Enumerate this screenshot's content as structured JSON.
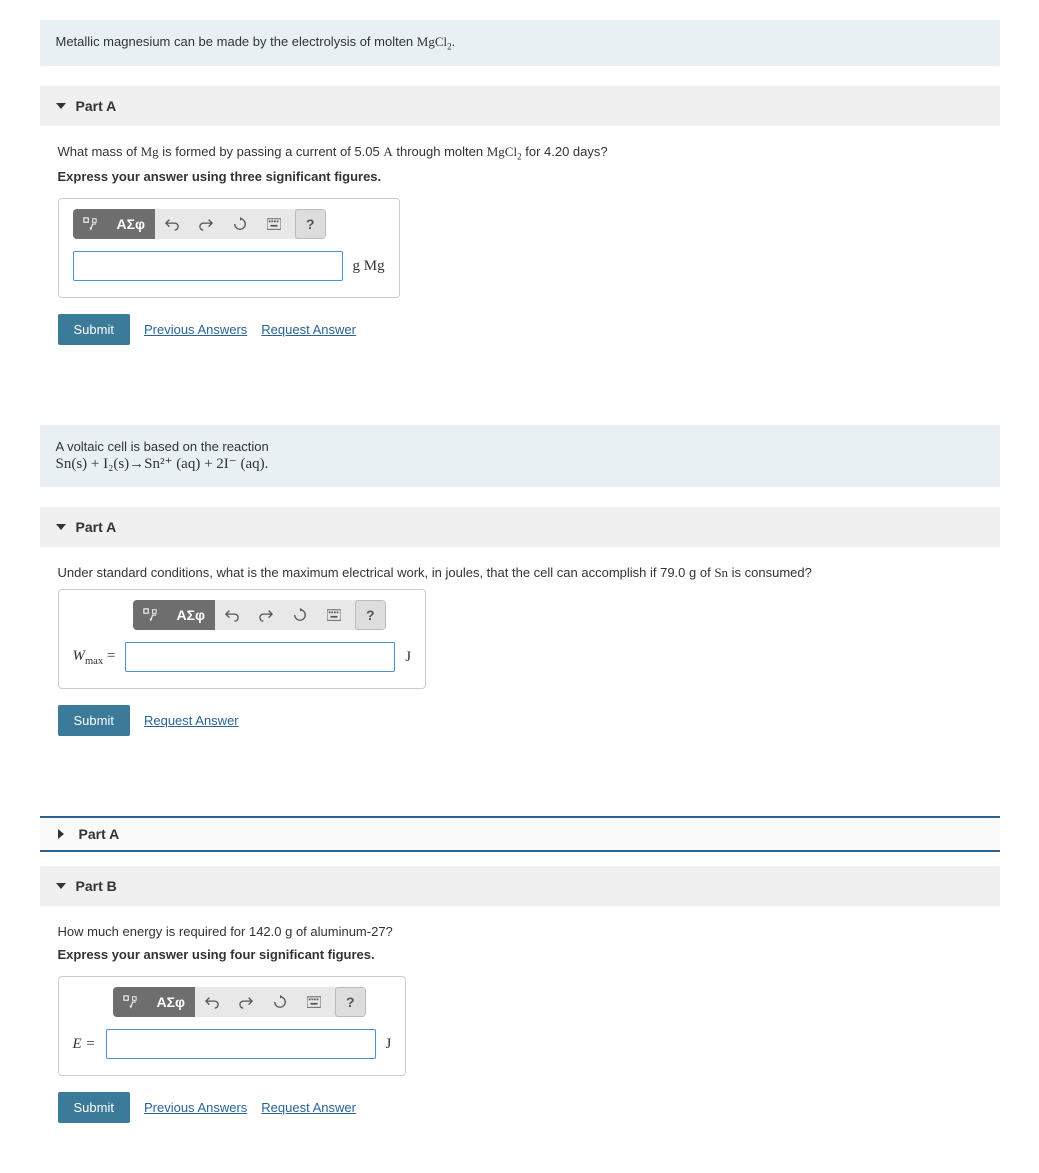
{
  "problem1": {
    "intro_pre": "Metallic magnesium can be made by the electrolysis of molten ",
    "intro_chem": "MgCl",
    "intro_sub": "2",
    "intro_post": ".",
    "partA": {
      "label": "Part A",
      "q_pre": "What mass of ",
      "q_chem1": "Mg",
      "q_mid": " is formed by passing a current of 5.05 ",
      "q_unitA": "A",
      "q_mid2": " through molten ",
      "q_chem2": "MgCl",
      "q_sub2": "2",
      "q_post": " for 4.20 days?",
      "instruction": "Express your answer using three significant figures.",
      "unit": "g Mg",
      "submit": "Submit",
      "prev_answers": "Previous Answers",
      "request": "Request Answer"
    }
  },
  "problem2": {
    "intro_line1": "A voltaic cell is based on the reaction",
    "eq": "Sn(s) + I₂(s)→Sn²⁺ (aq) + 2I⁻ (aq).",
    "partA": {
      "label": "Part A",
      "q_pre": "Under standard conditions, what is the maximum electrical work, in joules, that the cell can accomplish if 79.0 g of ",
      "q_chem": "Sn",
      "q_post": " is consumed?",
      "prefix": "W",
      "prefix_sub": "max",
      "prefix_eq": " =",
      "unit": "J",
      "submit": "Submit",
      "request": "Request Answer"
    }
  },
  "problem3": {
    "partA_label": "Part A",
    "partB": {
      "label": "Part B",
      "question": "How much energy is required for 142.0 g of aluminum-27?",
      "instruction": "Express your answer using four significant figures.",
      "prefix": "E =",
      "unit": "J",
      "submit": "Submit",
      "prev_answers": "Previous Answers",
      "request": "Request Answer"
    }
  },
  "toolbar": {
    "templates": "▢√▢",
    "greek": "ΑΣφ",
    "undo": "undo",
    "redo": "redo",
    "reset": "reset",
    "keyboard": "keyboard",
    "help": "?"
  },
  "chart_data": null
}
